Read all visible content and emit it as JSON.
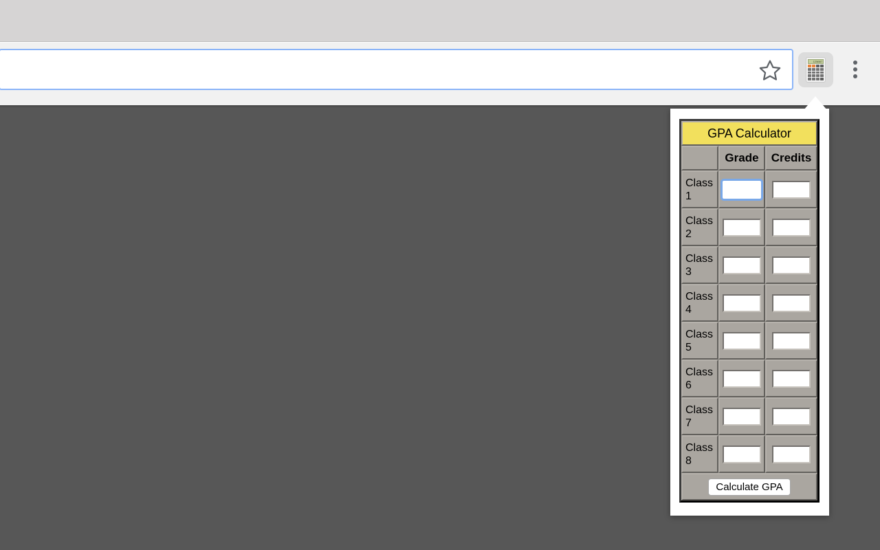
{
  "browser": {
    "omnibox": {
      "value": "",
      "placeholder": ""
    },
    "star_icon": "star-icon",
    "extension_icon": "calculator-icon",
    "extension_icon_screen_text": "1234567",
    "menu_icon": "three-dot-menu-icon"
  },
  "popup": {
    "title": "GPA Calculator",
    "columns": [
      "",
      "Grade",
      "Credits"
    ],
    "rows": [
      {
        "label": "Class 1",
        "grade": "",
        "credits": "",
        "grade_focused": true
      },
      {
        "label": "Class 2",
        "grade": "",
        "credits": "",
        "grade_focused": false
      },
      {
        "label": "Class 3",
        "grade": "",
        "credits": "",
        "grade_focused": false
      },
      {
        "label": "Class 4",
        "grade": "",
        "credits": "",
        "grade_focused": false
      },
      {
        "label": "Class 5",
        "grade": "",
        "credits": "",
        "grade_focused": false
      },
      {
        "label": "Class 6",
        "grade": "",
        "credits": "",
        "grade_focused": false
      },
      {
        "label": "Class 7",
        "grade": "",
        "credits": "",
        "grade_focused": false
      },
      {
        "label": "Class 8",
        "grade": "",
        "credits": "",
        "grade_focused": false
      }
    ],
    "calculate_button": "Calculate GPA"
  },
  "colors": {
    "title_background": "#f2e05d",
    "table_background": "#aaa6a0",
    "page_background": "#575757",
    "omnibox_focus_border": "#8ab4f8",
    "input_focus_ring": "#79a8e8"
  }
}
